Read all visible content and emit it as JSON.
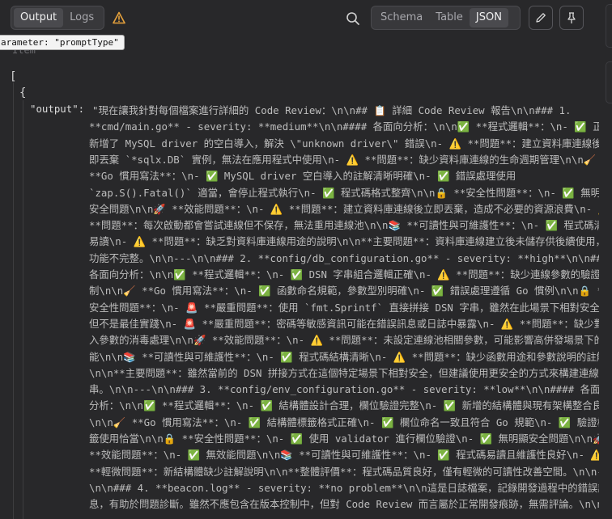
{
  "toolbar": {
    "tabs_left": [
      {
        "label": "Output",
        "active": true
      },
      {
        "label": "Logs",
        "active": false
      }
    ],
    "tabs_right": [
      {
        "label": "Schema",
        "active": false
      },
      {
        "label": "Table",
        "active": false
      },
      {
        "label": "JSON",
        "active": true
      }
    ],
    "warning_icon": "warning-triangle-icon",
    "search_icon": "search-icon",
    "edit_icon": "pencil-icon",
    "pin_icon": "pin-icon",
    "accent_warning": "#e6a23c"
  },
  "tooltip": "arameter: \"promptType\"",
  "item_label": "Item",
  "json": {
    "open_array": "[",
    "open_object": "{",
    "key": "\"output\":",
    "value_lines": [
      "\"現在讓我針對每個檔案進行詳細的 Code Review：\\n\\n## 📋 詳細 Code Review 報告\\n\\n### 1.",
      "**cmd/main.go** - severity: **medium**\\n\\n#### 各面向分析：\\n\\n✅ **程式邏輯**：\\n- ✅ 正確",
      "新增了 MySQL driver 的空白導入，解決 \\\"unknown driver\\\" 錯誤\\n- ⚠️ **問題**：建立資料庫連線後立",
      "即丟棄 `*sqlx.DB` 實例，無法在應用程式中使用\\n- ⚠️ **問題**：缺少資料庫連線的生命週期管理\\n\\n🧹",
      "**Go 慣用寫法**：\\n- ✅ MySQL driver 空白導入的註解清晰明確\\n- ✅ 錯誤處理使用",
      "`zap.S().Fatal()` 適當，會停止程式執行\\n- ✅ 程式碼格式整齊\\n\\n🔒 **安全性問題**：\\n- ✅ 無明顯",
      "安全問題\\n\\n🚀 **效能問題**：\\n- ⚠️ **問題**：建立資料庫連線後立即丟棄，造成不必要的資源浪費\\n- ⚠️",
      "**問題**：每次啟動都會嘗試連線但不保存，無法重用連線池\\n\\n📚 **可讀性與可維護性**：\\n- ✅ 程式碼清晰",
      "易讀\\n- ⚠️ **問題**：缺乏對資料庫連線用途的說明\\n\\n**主要問題**：資料庫連線建立後未儲存供後續使用，",
      "功能不完整。\\n\\n---\\n\\n### 2. **config/db_configuration.go** - severity: **high**\\n\\n####",
      "各面向分析：\\n\\n✅ **程式邏輯**：\\n- ✅ DSN 字串組合邏輯正確\\n- ⚠️ **問題**：缺少連線參數的驗證機",
      "制\\n\\n🧹 **Go 慣用寫法**：\\n- ✅ 函數命名規範，參數型別明確\\n- ✅ 錯誤處理遵循 Go 慣例\\n\\n🔒 **",
      "安全性問題**：\\n- 🚨 **嚴重問題**：使用 `fmt.Sprintf` 直接拼接 DSN 字串，雖然在此場景下相對安全，",
      "但不是最佳實踐\\n- 🚨 **嚴重問題**：密碼等敏感資訊可能在錯誤訊息或日誌中暴露\\n- ⚠️ **問題**：缺少對輸",
      "入參數的消毒處理\\n\\n🚀 **效能問題**：\\n- ⚠️ **問題**：未設定連線池相關參數，可能影響高併發場景下的效",
      "能\\n\\n📚 **可讀性與可維護性**：\\n- ✅ 程式碼結構清晰\\n- ⚠️ **問題**：缺少函數用途和參數說明的註解",
      "\\n\\n**主要問題**：雖然當前的 DSN 拼接方式在這個特定場景下相對安全，但建議使用更安全的方式來構建連線字",
      "串。\\n\\n---\\n\\n### 3. **config/env_configuration.go** - severity: **low**\\n\\n#### 各面向",
      "分析：\\n\\n✅ **程式邏輯**：\\n- ✅ 結構體設計合理，欄位驗證完整\\n- ✅ 新增的結構體與現有架構整合良好",
      "\\n\\n🧹 **Go 慣用寫法**：\\n- ✅ 結構體標籤格式正確\\n- ✅ 欄位命名一致且符合 Go 規範\\n- ✅ 驗證標",
      "籤使用恰當\\n\\n🔒 **安全性問題**：\\n- ✅ 使用 validator 進行欄位驗證\\n- ✅ 無明顯安全問題\\n\\n🚀",
      "**效能問題**：\\n- ✅ 無效能問題\\n\\n📚 **可讀性與可維護性**：\\n- ✅ 程式碼易讀且維護性良好\\n- ⚠️",
      "**輕微問題**：新結構體缺少註解說明\\n\\n**整體評價**：程式碼品質良好，僅有輕微的可讀性改善空間。\\n\\n---",
      "\\n\\n### 4. **beacon.log** - severity: **no problem**\\n\\n這是日誌檔案，記錄開發過程中的錯誤訊",
      "息，有助於問題診斷。雖然不應包含在版本控制中，但對 Code Review 而言屬於正常開發痕跡，無需評論。\\n\\n---"
    ]
  }
}
